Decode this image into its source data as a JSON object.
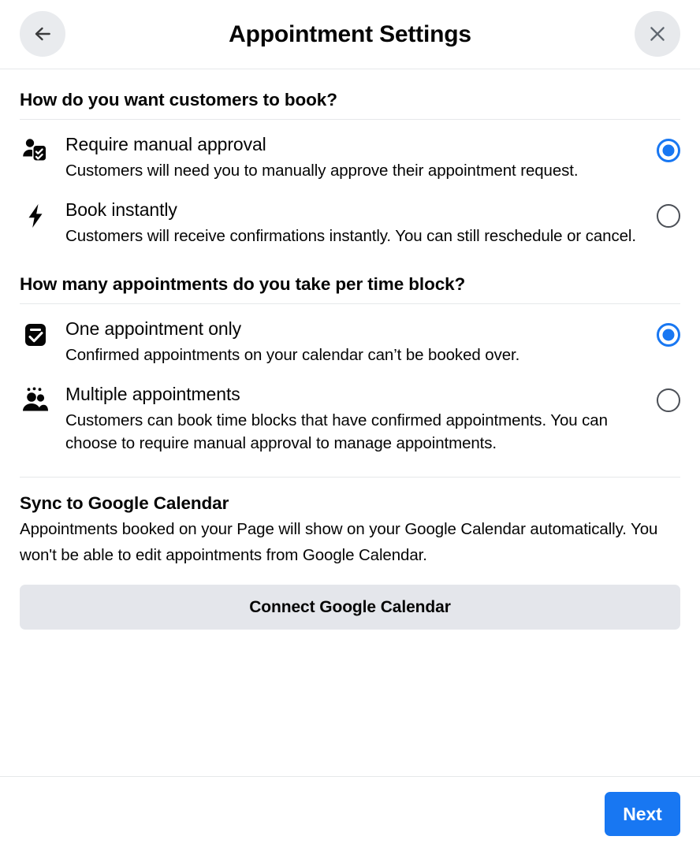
{
  "header": {
    "title": "Appointment Settings",
    "back_icon": "arrow-left-icon",
    "close_icon": "close-icon"
  },
  "sections": [
    {
      "heading": "How do you want customers to book?",
      "options": [
        {
          "icon": "person-checklist-icon",
          "title": "Require manual approval",
          "description": "Customers will need you to manually approve their appointment request.",
          "selected": true
        },
        {
          "icon": "lightning-bolt-icon",
          "title": "Book instantly",
          "description": "Customers will receive confirmations instantly. You can still reschedule or cancel.",
          "selected": false
        }
      ]
    },
    {
      "heading": "How many appointments do you take per time block?",
      "options": [
        {
          "icon": "single-checkbox-icon",
          "title": "One appointment only",
          "description": "Confirmed appointments on your calendar can’t be booked over.",
          "selected": true
        },
        {
          "icon": "people-group-icon",
          "title": "Multiple appointments",
          "description": "Customers can book time blocks that have confirmed appointments. You can choose to require manual approval to manage appointments.",
          "selected": false
        }
      ]
    }
  ],
  "sync": {
    "title": "Sync to Google Calendar",
    "description": "Appointments booked on your Page will show on your Google Calendar automatically. You won't be able to edit appointments from Google Calendar.",
    "connect_label": "Connect Google Calendar"
  },
  "footer": {
    "next_label": "Next"
  },
  "colors": {
    "accent": "#1877f2",
    "radio_off": "#4b4f56",
    "button_secondary_bg": "#e4e6eb",
    "icon_circle_bg": "#e9ebee",
    "divider": "#e6e8ea",
    "text": "#050505"
  }
}
